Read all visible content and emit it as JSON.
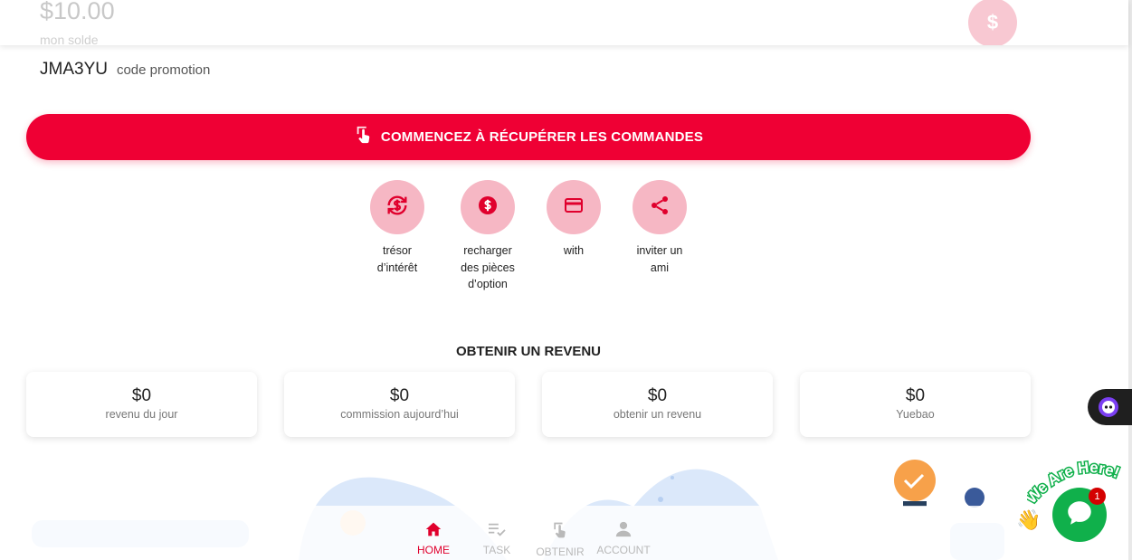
{
  "header": {
    "balance": "$10.00",
    "balance_label": "mon solde",
    "badge_symbol": "$"
  },
  "promo": {
    "code": "JMA3YU",
    "label": "code promotion"
  },
  "cta": {
    "label": "COMMENCEZ À RÉCUPÉRER LES COMMANDES",
    "icon": "tap-hand-icon"
  },
  "actions": [
    {
      "icon": "currency-exchange-icon",
      "line1": "trésor",
      "line2": "d’intérêt",
      "line3": ""
    },
    {
      "icon": "dollar-coin-icon",
      "line1": "recharger",
      "line2": "des pièces",
      "line3": "d’option"
    },
    {
      "icon": "credit-card-icon",
      "line1": "with",
      "line2": "",
      "line3": ""
    },
    {
      "icon": "share-icon",
      "line1": "inviter un",
      "line2": "ami",
      "line3": ""
    }
  ],
  "earnings": {
    "title": "OBTENIR UN REVENU",
    "cards": [
      {
        "value": "$0",
        "label": "revenu du jour"
      },
      {
        "value": "$0",
        "label": "commission aujourd’hui"
      },
      {
        "value": "$0",
        "label": "obtenir un revenu"
      },
      {
        "value": "$0",
        "label": "Yuebao"
      }
    ]
  },
  "nav": [
    {
      "label": "HOME",
      "icon": "home-icon",
      "active": true
    },
    {
      "label": "TASK",
      "icon": "task-list-icon",
      "active": false
    },
    {
      "label": "OBTENIR",
      "icon": "tap-hand-icon",
      "active": false
    },
    {
      "label": "ACCOUNT",
      "icon": "person-icon",
      "active": false
    }
  ],
  "chat": {
    "banner": "We Are Here!",
    "unread": "1"
  },
  "colors": {
    "accent": "#ef0034",
    "action_circle": "#f6b7c4",
    "chat_green": "#10b04b"
  }
}
